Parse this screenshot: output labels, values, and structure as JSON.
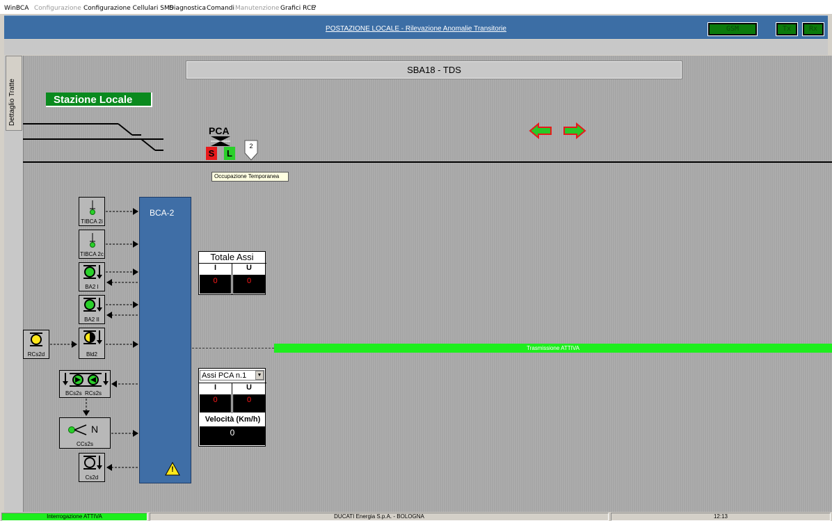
{
  "menu": [
    {
      "label": "WinBCA",
      "enabled": true
    },
    {
      "label": "Configurazione",
      "enabled": false
    },
    {
      "label": "Configurazione Cellulari SMS",
      "enabled": true
    },
    {
      "label": "Diagnostica",
      "enabled": true
    },
    {
      "label": "Comandi",
      "enabled": true
    },
    {
      "label": "Manutenzione",
      "enabled": false
    },
    {
      "label": "Grafici RCE",
      "enabled": true
    },
    {
      "label": "?",
      "enabled": true
    }
  ],
  "titlebar": {
    "title": "POSTAZIONE LOCALE - Rilevazione Anomalie Transitorie",
    "indicators": [
      "GSM",
      "Tx",
      "Rx"
    ]
  },
  "sidetab": {
    "label": "Dettaglio Tratte"
  },
  "station": {
    "header": "SBA18 - TDS",
    "label": "Stazione Locale"
  },
  "track": {
    "pca_label": "PCA",
    "s_label": "S",
    "l_label": "L",
    "section_number": "2",
    "tooltip": "Occupazione Temporanea"
  },
  "devices": {
    "tibca_2i": "TIBCA 2i",
    "tibca_2c": "TIBCA 2c",
    "ba2_i": "BA2 I",
    "ba2_ii": "BA2 II",
    "rcs2d": "RCs2d",
    "bld2": "Bld2",
    "bcs2s": "BCs2s",
    "rcs2s": "RCs2s",
    "ccs2s": "CCs2s",
    "cs2d": "Cs2d",
    "ccs2s_letter": "N"
  },
  "bca": {
    "label": "BCA-2",
    "warning": "!"
  },
  "totale_assi": {
    "title": "Totale Assi",
    "col_i": "I",
    "col_u": "U",
    "value_i": "0",
    "value_u": "0"
  },
  "assi_pca": {
    "selected": "Assi PCA n.1",
    "col_i": "I",
    "col_u": "U",
    "value_i": "0",
    "value_u": "0",
    "speed_label": "Velocità (Km/h)",
    "speed_value": "0"
  },
  "trasmissione": "Trasmissione ATTIVA",
  "statusbar": {
    "interrogazione": "Interrogazione ATTIVA",
    "company": "DUCATI Energia S.p.A.  -  BOLOGNA",
    "time": "12:13"
  },
  "colors": {
    "bca_blue": "#3f6ea6",
    "active_green": "#1eee1e",
    "alarm_red": "#e8191b",
    "ok_green": "#2ad02a"
  }
}
